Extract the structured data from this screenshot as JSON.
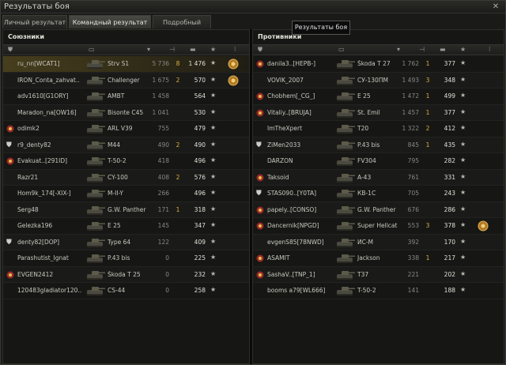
{
  "window": {
    "title": "Результаты боя"
  },
  "tabs": [
    {
      "label": "Личный результат"
    },
    {
      "label": "Командный результат"
    },
    {
      "label": "Подробный отчёт"
    }
  ],
  "tooltip": "Результаты боя",
  "left": {
    "title": "Союзники",
    "rows": [
      {
        "player": "ru_nn[WCAT1]",
        "vehicle": "Strv S1",
        "xp": "5 736",
        "kills": "8",
        "dmg": "1 476",
        "highlight": true,
        "medal": true
      },
      {
        "player": "IRON_Conta_zahvat..",
        "vehicle": "Challenger",
        "xp": "1 675",
        "kills": "2",
        "dmg": "570",
        "medal": true
      },
      {
        "player": "adv1610[G1ORY]",
        "vehicle": "AMBT",
        "xp": "1 458",
        "kills": "",
        "dmg": "564"
      },
      {
        "player": "Maradon_na[OW16]",
        "vehicle": "Bisonte C45",
        "xp": "1 041",
        "kills": "",
        "dmg": "530"
      },
      {
        "player": "odimk2",
        "vehicle": "ARL V39",
        "xp": "755",
        "kills": "",
        "dmg": "479",
        "icon": true
      },
      {
        "player": "r9_denty82",
        "vehicle": "M44",
        "xp": "490",
        "kills": "2",
        "dmg": "490",
        "shield": true
      },
      {
        "player": "Evakuat..[291ID]",
        "vehicle": "T-50-2",
        "xp": "418",
        "kills": "",
        "dmg": "496",
        "icon": true
      },
      {
        "player": "Razr21",
        "vehicle": "CY-100",
        "xp": "408",
        "kills": "2",
        "dmg": "576"
      },
      {
        "player": "Hom9k_174[-XIX-]",
        "vehicle": "M-II-Y",
        "xp": "266",
        "kills": "",
        "dmg": "496"
      },
      {
        "player": "Serg48",
        "vehicle": "G.W. Panther",
        "xp": "171",
        "kills": "1",
        "dmg": "318"
      },
      {
        "player": "Gelezka196",
        "vehicle": "E 25",
        "xp": "145",
        "kills": "",
        "dmg": "347"
      },
      {
        "player": "denty82[DOP]",
        "vehicle": "Type 64",
        "xp": "122",
        "kills": "",
        "dmg": "409",
        "shield": true,
        "icon": true
      },
      {
        "player": "Parashutist_Ignat",
        "vehicle": "P.43 bis",
        "xp": "0",
        "kills": "",
        "dmg": "225"
      },
      {
        "player": "EVGEN2412",
        "vehicle": "Škoda T 25",
        "xp": "0",
        "kills": "",
        "dmg": "232",
        "icon": true
      },
      {
        "player": "120483gladiator120..",
        "vehicle": "CS-44",
        "xp": "0",
        "kills": "",
        "dmg": "258"
      }
    ]
  },
  "right": {
    "title": "Противники",
    "rows": [
      {
        "player": "danila3..[HEPB-]",
        "vehicle": "Škoda T 27",
        "xp": "1 762",
        "kills": "1",
        "dmg": "377",
        "icon": true
      },
      {
        "player": "VOVIK_2007",
        "vehicle": "СУ-130ПМ",
        "xp": "1 493",
        "kills": "3",
        "dmg": "348"
      },
      {
        "player": "Chobhem[_CG_]",
        "vehicle": "E 25",
        "xp": "1 472",
        "kills": "1",
        "dmg": "499",
        "icon": true
      },
      {
        "player": "Vitaliy..[BRUJA]",
        "vehicle": "St. Emil",
        "xp": "1 457",
        "kills": "1",
        "dmg": "377",
        "icon": true
      },
      {
        "player": "ImTheXpert",
        "vehicle": "T20",
        "xp": "1 322",
        "kills": "2",
        "dmg": "412"
      },
      {
        "player": "ZiMen2033",
        "vehicle": "P.43 bis",
        "xp": "845",
        "kills": "1",
        "dmg": "435",
        "shield": true,
        "icon": true
      },
      {
        "player": "DARZON",
        "vehicle": "FV304",
        "xp": "795",
        "kills": "",
        "dmg": "282"
      },
      {
        "player": "Taksoid",
        "vehicle": "A-43",
        "xp": "761",
        "kills": "",
        "dmg": "331",
        "icon": true
      },
      {
        "player": "STAS090..[Y0TA]",
        "vehicle": "КВ-1С",
        "xp": "705",
        "kills": "",
        "dmg": "243",
        "shield": true,
        "icon": true
      },
      {
        "player": "papely..[CONSO]",
        "vehicle": "G.W. Panther",
        "xp": "676",
        "kills": "",
        "dmg": "286",
        "icon": true
      },
      {
        "player": "Dancernik[NPGD]",
        "vehicle": "Super Hellcat",
        "xp": "553",
        "kills": "3",
        "dmg": "378",
        "icon": true,
        "medal": true
      },
      {
        "player": "evgenS85[78NWD]",
        "vehicle": "ИС-М",
        "xp": "392",
        "kills": "",
        "dmg": "170"
      },
      {
        "player": "ASAMIT",
        "vehicle": "Jackson",
        "xp": "338",
        "kills": "1",
        "dmg": "217",
        "icon": true
      },
      {
        "player": "SashaV..[TNP_1]",
        "vehicle": "T37",
        "xp": "221",
        "kills": "",
        "dmg": "202",
        "icon": true
      },
      {
        "player": "booms a79[WL666]",
        "vehicle": "T-50-2",
        "xp": "141",
        "kills": "",
        "dmg": "188"
      }
    ]
  },
  "colors": {
    "accent": "#d8b040",
    "highlight": "#826e28"
  },
  "icons": [
    "close-icon",
    "star-icon",
    "shield-icon",
    "medal-icon",
    "tank-icon",
    "clan-emblem-icon"
  ]
}
